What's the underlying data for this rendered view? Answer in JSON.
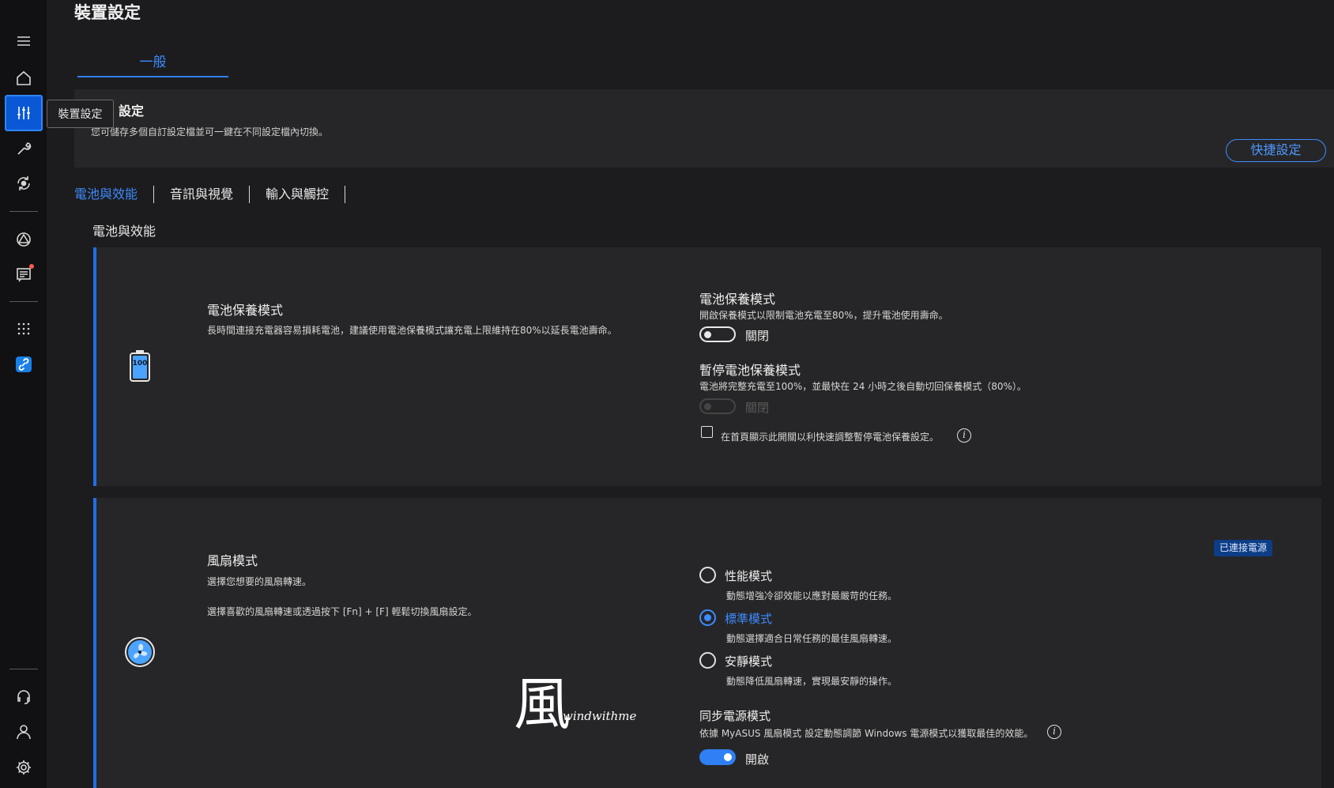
{
  "sidebar": {
    "items": [
      "menu-icon",
      "home-icon",
      "device-settings-icon",
      "wrench-icon",
      "refresh-icon",
      "triangle-icon",
      "news-icon",
      "apps-icon",
      "link-icon",
      "support-icon",
      "user-icon",
      "gear-icon"
    ],
    "tooltip": "裝置設定"
  },
  "header": {
    "title": "裝置設定",
    "tab": "一般"
  },
  "profile": {
    "title": "設定",
    "description": "您可儲存多個自訂設定檔並可一鍵在不同設定檔內切換。",
    "quick_button": "快捷設定"
  },
  "subtabs": [
    "電池與效能",
    "音訊與視覺",
    "輸入與觸控"
  ],
  "section_label": "電池與效能",
  "battery_card": {
    "title": "電池保養模式",
    "description": "長時間連接充電器容易損耗電池，建議使用電池保養模式讓充電上限維持在80%以延長電池壽命。",
    "icon_label": "100",
    "care_mode_title": "電池保養模式",
    "care_mode_desc": "開啟保養模式以限制電池充電至80%，提升電池使用壽命。",
    "care_mode_state": "關閉",
    "pause_title": "暫停電池保養模式",
    "pause_desc": "電池將完整充電至100%，並最快在 24 小時之後自動切回保養模式（80%）。",
    "pause_state": "關閉",
    "checkbox_label": "在首頁顯示此開關以利快速調整暫停電池保養設定。"
  },
  "fan_card": {
    "title": "風扇模式",
    "description1": "選擇您想要的風扇轉速。",
    "description2": "選擇喜歡的風扇轉速或透過按下 [Fn] + [F] 輕鬆切換風扇設定。",
    "badge": "已連接電源",
    "options": [
      {
        "label": "性能模式",
        "desc": "動態增強冷卻效能以應對最嚴苛的任務。",
        "selected": false
      },
      {
        "label": "標準模式",
        "desc": "動態選擇適合日常任務的最佳風扇轉速。",
        "selected": true
      },
      {
        "label": "安靜模式",
        "desc": "動態降低風扇轉速，實現最安靜的操作。",
        "selected": false
      }
    ],
    "sync_title": "同步電源模式",
    "sync_desc": "依據 MyASUS 風扇模式 設定動態調節 Windows 電源模式以獲取最佳的效能。",
    "sync_state": "開啟"
  },
  "watermark": {
    "glyph": "風",
    "text": "windwithme"
  },
  "colors": {
    "accent": "#3d8bff",
    "active_sidebar": "#0a58d6",
    "card": "#262628",
    "background": "#1c1c1e"
  }
}
